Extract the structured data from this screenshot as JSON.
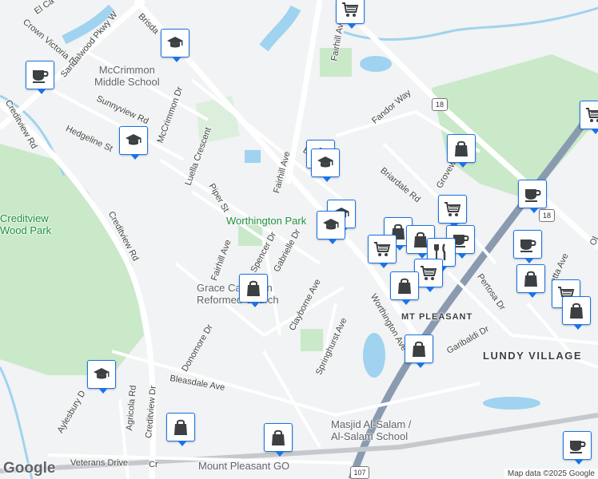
{
  "map": {
    "attribution": "Map data ©2025 Google",
    "logo": "Google",
    "colors": {
      "marker_border": "#1a73e8",
      "park": "#c9e9c9",
      "water": "#9fd3ef",
      "highway": "#8a9bb0"
    }
  },
  "places": {
    "worthington_park": "Worthington Park",
    "mccrimmon_school": "McCrimmon\nMiddle School",
    "grace_church": "Grace Canadian\nReformed Church",
    "masjid": "Masjid Al-Salam /\nAl-Salam School",
    "mount_pleasant_go": "Mount Pleasant GO",
    "creditview_park": "Creditview\nWood Park",
    "mt_pleasant": "MT PLEASANT",
    "lundy_village": "LUNDY VILLAGE"
  },
  "streets": {
    "crown_victoria": "Crown Victoria Dr",
    "sandalwood": "Sandalwood Pkwy W",
    "creditview_rd_upper": "Creditview Rd",
    "creditview_rd_mid": "Creditview Rd",
    "creditview_dr_low": "Creditview Dr",
    "sunnyview": "Sunnyview Rd",
    "mccrimmon_dr": "McCrimmon Dr",
    "hedgeline": "Hedgeline St",
    "luella": "Luella Crescent",
    "piper": "Piper St",
    "fairhill_upper": "Fairhill Ave",
    "fairhill_mid": "Fairhill Ave",
    "fairhill_low": "Fairhill Ave",
    "spencer": "Spencer Dr",
    "gabrielle": "Gabrielle Dr",
    "claybourne": "Clayborne Ave",
    "springhurst": "Springhurst Ave",
    "worthington_ave": "Worthington Ave",
    "fandor": "Fandor Way",
    "briardale": "Briardale Rd",
    "grovewood": "Grovewo",
    "pertosa": "Pertosa Dr",
    "garibaldi": "Garibaldi Dr",
    "donomore": "Donomore Dr",
    "bleasdale": "Bleasdale Ave",
    "agricola": "Agricola Rd",
    "aylesbury": "Aylesbury D",
    "veterans": "Veterans Drive",
    "el_ca": "El Ca",
    "brisdale": "Brisda",
    "bri_dr": "Br      Dr",
    "etta": "etta Ave",
    "ol": "Ol",
    "cr": "Cr"
  },
  "shields": {
    "r18_a": "18",
    "r18_b": "18",
    "r107": "107"
  },
  "markers": [
    {
      "type": "shopping-cart"
    },
    {
      "type": "school"
    },
    {
      "type": "cafe"
    },
    {
      "type": "school"
    },
    {
      "type": "shopping-bag"
    },
    {
      "type": "shopping-cart"
    },
    {
      "type": "school"
    },
    {
      "type": "school"
    },
    {
      "type": "school"
    },
    {
      "type": "cafe"
    },
    {
      "type": "shopping-bag"
    },
    {
      "type": "shopping-cart"
    },
    {
      "type": "shopping-bag"
    },
    {
      "type": "restaurant"
    },
    {
      "type": "cafe"
    },
    {
      "type": "shopping-cart"
    },
    {
      "type": "shopping-bag"
    },
    {
      "type": "shopping-cart"
    },
    {
      "type": "cafe"
    },
    {
      "type": "shopping-bag"
    },
    {
      "type": "shopping-bag"
    },
    {
      "type": "school"
    },
    {
      "type": "shopping-bag"
    },
    {
      "type": "shopping-bag"
    },
    {
      "type": "cafe"
    },
    {
      "type": "shopping-cart"
    },
    {
      "type": "shopping-bag"
    }
  ]
}
